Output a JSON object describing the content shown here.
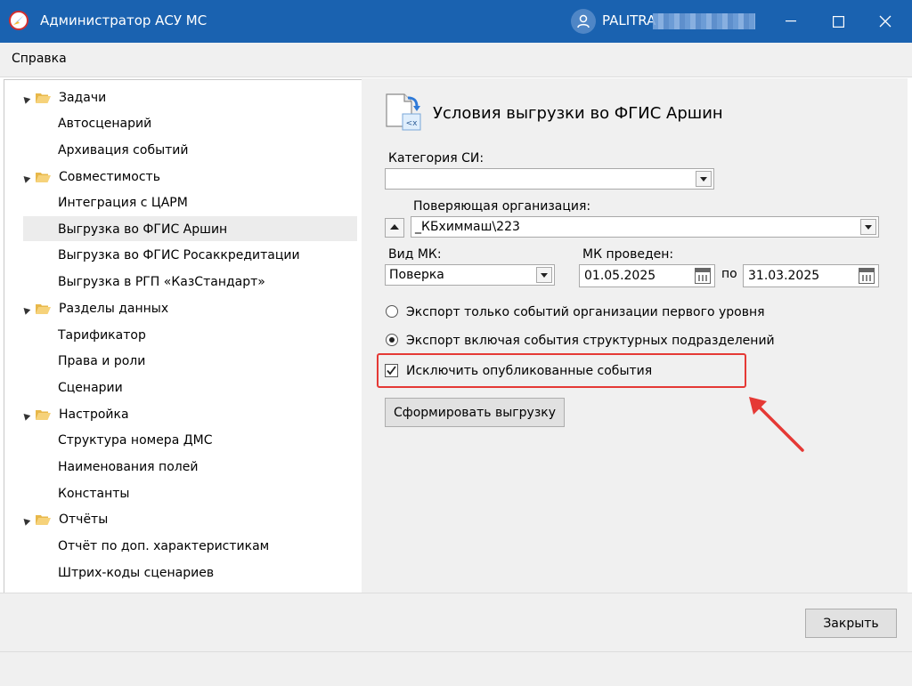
{
  "window": {
    "title": "Администратор АСУ МС",
    "user": "PALITRA"
  },
  "menu": {
    "help": "Справка"
  },
  "tree": {
    "groups": [
      {
        "label": "Задачи",
        "items": [
          "Автосценарий",
          "Архивация событий"
        ]
      },
      {
        "label": "Совместимость",
        "items": [
          "Интеграция с ЦАРМ",
          "Выгрузка во ФГИС Аршин",
          "Выгрузка во ФГИС Росаккредитации",
          "Выгрузка в РГП «КазСтандарт»"
        ]
      },
      {
        "label": "Разделы данных",
        "items": [
          "Тарификатор",
          "Права и роли",
          "Сценарии"
        ]
      },
      {
        "label": "Настройка",
        "items": [
          "Структура номера ДМС",
          "Наименования полей",
          "Константы"
        ]
      },
      {
        "label": "Отчёты",
        "items": [
          "Отчёт по доп. характеристикам",
          "Штрих-коды сценариев"
        ]
      }
    ],
    "selected": "Выгрузка во ФГИС Аршин"
  },
  "form": {
    "title": "Условия выгрузки во ФГИС Аршин",
    "category_label": "Категория СИ:",
    "category_value": "",
    "org_label": "Поверяющая организация:",
    "org_value": "_КБхиммаш\\223",
    "mk_type_label": "Вид МК:",
    "mk_type_value": "Поверка",
    "mk_done_label": "МК проведен:",
    "date_from": "01.05.2025",
    "date_to_label": "по",
    "date_to": "31.03.2025",
    "radio1_label": "Экспорт только событий организации первого уровня",
    "radio1_selected": false,
    "radio2_label": "Экспорт включая события структурных подразделений",
    "radio2_selected": true,
    "checkbox_label": "Исключить опубликованные события",
    "checkbox_checked": true,
    "generate_button": "Сформировать выгрузку"
  },
  "footer": {
    "close_button": "Закрыть"
  },
  "colors": {
    "titlebar": "#1a62b0",
    "highlight": "#e53935"
  }
}
